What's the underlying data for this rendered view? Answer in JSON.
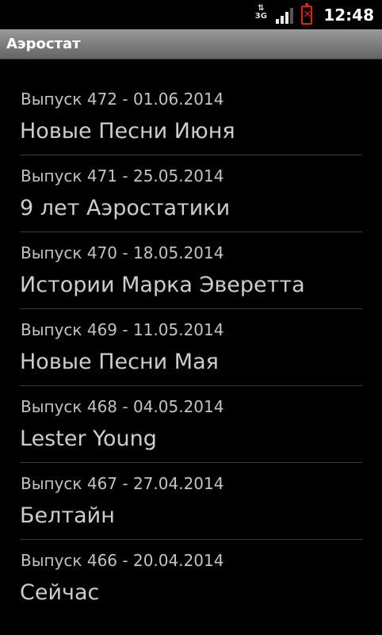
{
  "status_bar": {
    "network": "3G",
    "time": "12:48"
  },
  "title_bar": {
    "title": "Аэростат"
  },
  "episodes": [
    {
      "subtitle": "Выпуск 472 - 01.06.2014",
      "title": "Новые Песни Июня"
    },
    {
      "subtitle": "Выпуск 471 - 25.05.2014",
      "title": "9 лет Аэростатики"
    },
    {
      "subtitle": "Выпуск 470 - 18.05.2014",
      "title": "Истории Марка Эверетта"
    },
    {
      "subtitle": "Выпуск 469 - 11.05.2014",
      "title": "Новые Песни Мая"
    },
    {
      "subtitle": "Выпуск 468 - 04.05.2014",
      "title": "Lester Young"
    },
    {
      "subtitle": "Выпуск 467 - 27.04.2014",
      "title": "Белтайн"
    },
    {
      "subtitle": "Выпуск 466 - 20.04.2014",
      "title": "Сейчас"
    }
  ]
}
